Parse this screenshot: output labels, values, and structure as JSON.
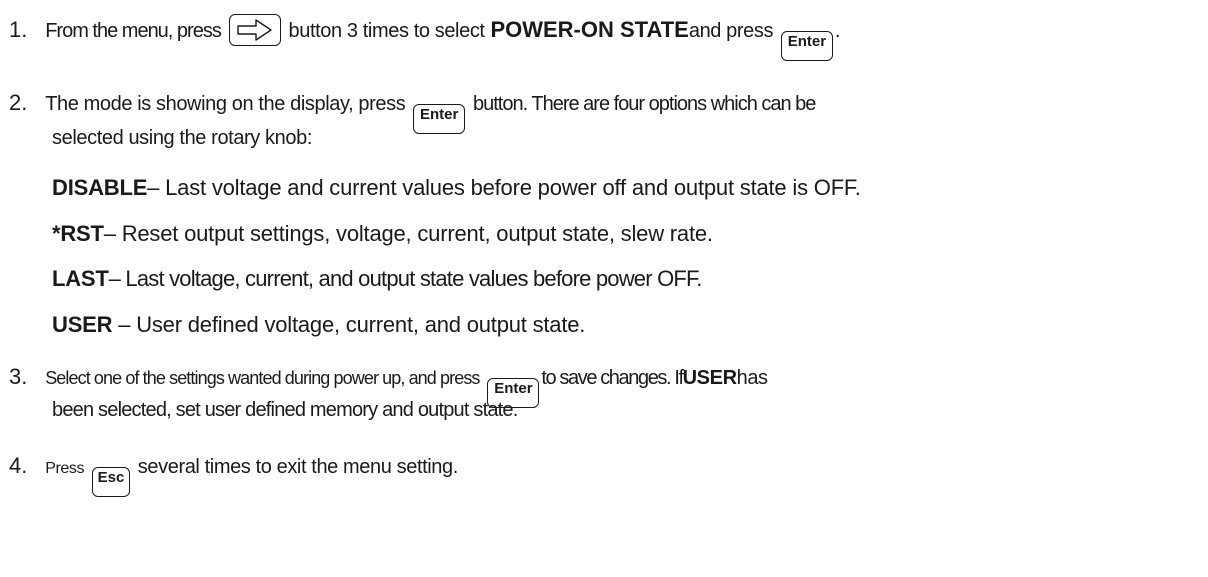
{
  "steps": [
    {
      "num": "1.",
      "t1": "From the menu, press",
      "t2": "button 3 times to select",
      "bold": "POWER-ON STATE",
      "t3": "and press",
      "t4": "."
    },
    {
      "num": "2.",
      "t1": "The mode is showing on the display, press",
      "t2": "button. There are four options which can be",
      "t3": "selected using the rotary knob:"
    },
    {
      "num": "3.",
      "t1": "Select one of the settings wanted during power up, and press",
      "t2": "to save changes. If",
      "bold": "USER",
      "t3": "has",
      "t4": "been selected, set user defined memory and output state."
    },
    {
      "num": "4.",
      "t1": "Press",
      "t2": "several times to exit the menu setting."
    }
  ],
  "options": [
    {
      "name": "DISABLE",
      "desc": "– Last voltage and current values before power off and output state is OFF."
    },
    {
      "name": "*RST",
      "desc": "– Reset output settings, voltage, current, output state, slew rate."
    },
    {
      "name": "LAST",
      "desc": "– Last voltage, current, and output state values before power OFF."
    },
    {
      "name": "USER",
      "desc": " – User defined voltage, current, and output state."
    }
  ],
  "keys": {
    "enter": "Enter",
    "esc": "Esc"
  },
  "icons": {
    "arrow": "right-arrow-key-icon"
  }
}
